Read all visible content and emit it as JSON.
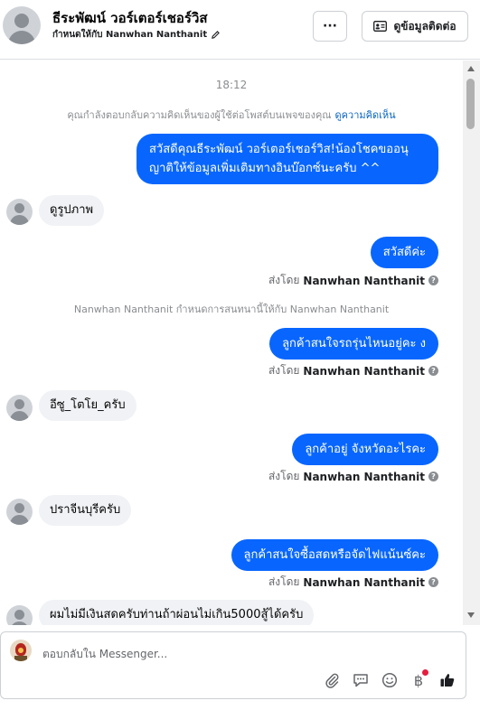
{
  "header": {
    "name": "ธีระพัฒน์ วอร์เตอร์เชอร์วิส",
    "assigned_label": "กำหนดให้กับ Nanwhan Nanthanit",
    "more_label": "···",
    "contact_button_label": "ดูข้อมูลติดต่อ"
  },
  "conversation": {
    "timestamp": "18:12",
    "notice_text": "คุณกำลังตอบกลับความคิดเห็นของผู้ใช้ต่อโพสต์บนเพจของคุณ",
    "notice_link": "ดูความคิดเห็น",
    "messages": [
      {
        "dir": "out",
        "text_line1": "สวัสดีคุณธีระพัฒน์ วอร์เตอร์เชอร์วิส!น้องโชคขออนุ",
        "text_line2": "ญาติให้ข้อมูลเพิ่มเติมทางอินบ๊อกซ์นะครับ ^^"
      },
      {
        "dir": "in",
        "text": "ดูรูปภาพ"
      },
      {
        "dir": "out",
        "text": "สวัสดีค่ะ",
        "sent_by_prefix": "ส่งโดย",
        "sent_by_name": "Nanwhan Nanthanit"
      },
      {
        "dir": "system",
        "text": "Nanwhan Nanthanit กำหนดการสนทนานี้ให้กับ Nanwhan Nanthanit"
      },
      {
        "dir": "out",
        "text": "ลูกค้าสนใจรถรุ่นไหนอยู่คะ ง",
        "sent_by_prefix": "ส่งโดย",
        "sent_by_name": "Nanwhan Nanthanit"
      },
      {
        "dir": "in",
        "text": "อีซู_โตโย_ครับ"
      },
      {
        "dir": "out",
        "text": "ลูกค้าอยู่ จังหวัดอะไรคะ",
        "sent_by_prefix": "ส่งโดย",
        "sent_by_name": "Nanwhan Nanthanit"
      },
      {
        "dir": "in",
        "text": "ปราจีนบุรีครับ"
      },
      {
        "dir": "out",
        "text": "ลูกค้าสนใจซื้อสดหรือจัดไฟแน้นซ์คะ",
        "sent_by_prefix": "ส่งโดย",
        "sent_by_name": "Nanwhan Nanthanit"
      },
      {
        "dir": "in",
        "text": "ผมไม่มีเงินสดครับท่านถ้าผ่อนไม่เกิน5000สู้ได้ครับ"
      }
    ]
  },
  "composer": {
    "placeholder": "ตอบกลับใน Messenger...",
    "tool_icons": [
      "paperclip-icon",
      "chat-bubble-icon",
      "emoji-icon",
      "baht-icon",
      "thumbs-up-icon"
    ],
    "baht_symbol": "฿"
  },
  "colors": {
    "accent": "#0866ff",
    "incoming_bubble": "#f0f2f5",
    "link": "#0a66c2"
  }
}
